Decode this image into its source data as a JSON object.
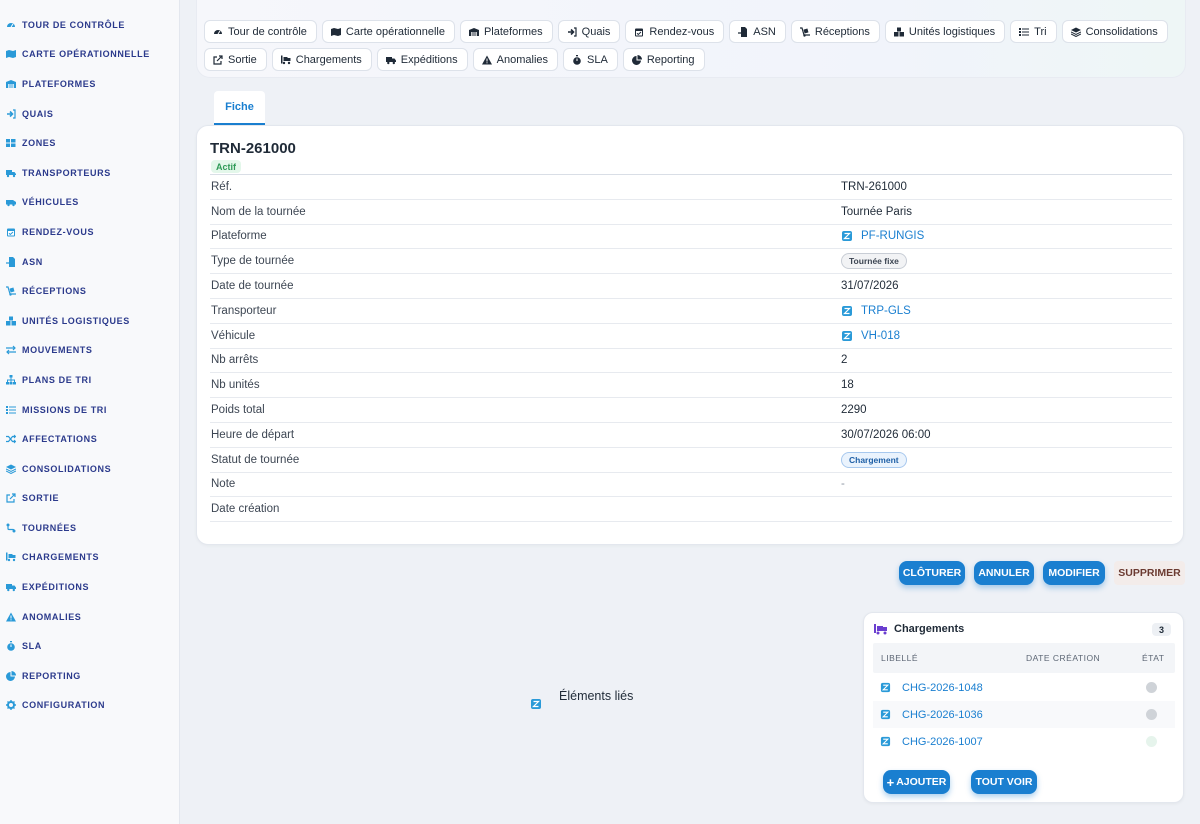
{
  "sidebar": {
    "items": [
      {
        "label": "TOUR DE CONTRÔLE",
        "icon": "gauge-icon"
      },
      {
        "label": "CARTE OPÉRATIONNELLE",
        "icon": "map-icon"
      },
      {
        "label": "PLATEFORMES",
        "icon": "warehouse-icon"
      },
      {
        "label": "QUAIS",
        "icon": "sign-in-icon"
      },
      {
        "label": "ZONES",
        "icon": "grid-icon"
      },
      {
        "label": "TRANSPORTEURS",
        "icon": "truck-icon"
      },
      {
        "label": "VÉHICULES",
        "icon": "van-icon"
      },
      {
        "label": "RENDEZ-VOUS",
        "icon": "calendar-icon"
      },
      {
        "label": "ASN",
        "icon": "file-import-icon"
      },
      {
        "label": "RÉCEPTIONS",
        "icon": "dolly-icon"
      },
      {
        "label": "UNITÉS LOGISTIQUES",
        "icon": "boxes-icon"
      },
      {
        "label": "MOUVEMENTS",
        "icon": "arrows-exchange-icon"
      },
      {
        "label": "PLANS DE TRI",
        "icon": "sitemap-icon"
      },
      {
        "label": "MISSIONS DE TRI",
        "icon": "list-icon"
      },
      {
        "label": "AFFECTATIONS",
        "icon": "shuffle-icon"
      },
      {
        "label": "CONSOLIDATIONS",
        "icon": "layers-icon"
      },
      {
        "label": "SORTIE",
        "icon": "export-icon"
      },
      {
        "label": "TOURNÉES",
        "icon": "route-icon"
      },
      {
        "label": "CHARGEMENTS",
        "icon": "truck-loading-icon"
      },
      {
        "label": "EXPÉDITIONS",
        "icon": "shipping-icon"
      },
      {
        "label": "ANOMALIES",
        "icon": "warning-icon"
      },
      {
        "label": "SLA",
        "icon": "stopwatch-icon"
      },
      {
        "label": "REPORTING",
        "icon": "pie-chart-icon"
      },
      {
        "label": "CONFIGURATION",
        "icon": "gear-icon"
      }
    ]
  },
  "topnav": {
    "row1": [
      {
        "label": "Tour de contrôle",
        "icon": "gauge-icon"
      },
      {
        "label": "Carte opérationnelle",
        "icon": "map-icon"
      },
      {
        "label": "Plateformes",
        "icon": "warehouse-icon"
      },
      {
        "label": "Quais",
        "icon": "sign-in-icon"
      },
      {
        "label": "Rendez-vous",
        "icon": "calendar-icon"
      },
      {
        "label": "ASN",
        "icon": "file-import-icon"
      },
      {
        "label": "Réceptions",
        "icon": "dolly-icon"
      },
      {
        "label": "Unités logistiques",
        "icon": "boxes-icon"
      },
      {
        "label": "Tri",
        "icon": "list-icon"
      },
      {
        "label": "Consolidations",
        "icon": "layers-icon"
      }
    ],
    "row2": [
      {
        "label": "Sortie",
        "icon": "export-icon"
      },
      {
        "label": "Chargements",
        "icon": "truck-loading-icon"
      },
      {
        "label": "Expéditions",
        "icon": "shipping-icon"
      },
      {
        "label": "Anomalies",
        "icon": "warning-icon"
      },
      {
        "label": "SLA",
        "icon": "stopwatch-icon"
      },
      {
        "label": "Reporting",
        "icon": "pie-chart-icon"
      }
    ]
  },
  "tab": {
    "label": "Fiche"
  },
  "record": {
    "title": "TRN-261000",
    "status": "Actif",
    "fields": [
      {
        "label": "Réf.",
        "value": "TRN-261000",
        "kind": "text"
      },
      {
        "label": "Nom de la tournée",
        "value": "Tournée Paris",
        "kind": "text"
      },
      {
        "label": "Plateforme",
        "value": "PF-RUNGIS",
        "kind": "link"
      },
      {
        "label": "Type de tournée",
        "value": "Tournée fixe",
        "kind": "badge-grey"
      },
      {
        "label": "Date de tournée",
        "value": "31/07/2026",
        "kind": "text"
      },
      {
        "label": "Transporteur",
        "value": "TRP-GLS",
        "kind": "link"
      },
      {
        "label": "Véhicule",
        "value": "VH-018",
        "kind": "link"
      },
      {
        "label": "Nb arrêts",
        "value": "2",
        "kind": "text"
      },
      {
        "label": "Nb unités",
        "value": "18",
        "kind": "text"
      },
      {
        "label": "Poids total",
        "value": "2290",
        "kind": "text"
      },
      {
        "label": "Heure de départ",
        "value": "30/07/2026 06:00",
        "kind": "text"
      },
      {
        "label": "Statut de tournée",
        "value": "Chargement",
        "kind": "badge-blue"
      },
      {
        "label": "Note",
        "value": "-",
        "kind": "dash"
      },
      {
        "label": "Date création",
        "value": "",
        "kind": "text"
      }
    ]
  },
  "actions": {
    "close": "CLÔTURER",
    "cancel": "ANNULER",
    "edit": "MODIFIER",
    "delete": "SUPPRIMER"
  },
  "linked": {
    "label": "Éléments liés"
  },
  "chargements": {
    "title": "Chargements",
    "count": "3",
    "columns": [
      "LIBELLÉ",
      "DATE CRÉATION",
      "ÉTAT"
    ],
    "rows": [
      {
        "label": "CHG-2026-1048",
        "date": "",
        "state_color": "#cfd3d8"
      },
      {
        "label": "CHG-2026-1036",
        "date": "",
        "state_color": "#cfd3d8"
      },
      {
        "label": "CHG-2026-1007",
        "date": "",
        "state_color": "#e6f4ec"
      }
    ],
    "add_label": "AJOUTER",
    "add_icon": "+",
    "see_all_label": "TOUT VOIR"
  },
  "colors": {
    "accent": "#1a7fd0",
    "sidebar_text": "#2b3a8c",
    "active_green": "#2e9a57",
    "icon_teal": "#2a9ad8",
    "chargements_icon": "#6b3fd0"
  }
}
